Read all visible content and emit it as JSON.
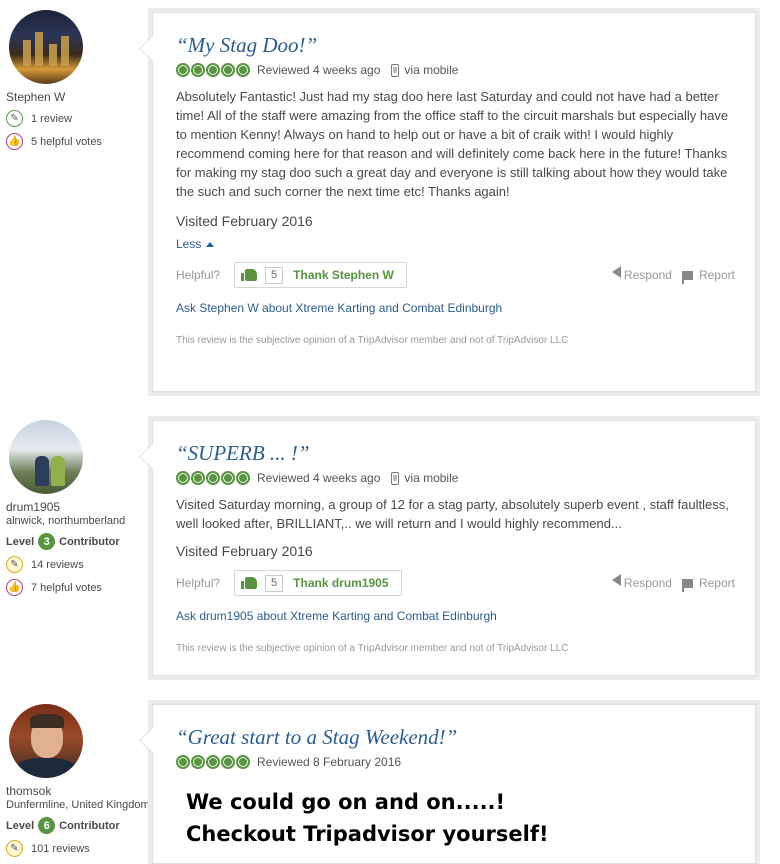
{
  "reviews": [
    {
      "member": {
        "name": "Stephen W",
        "location": "",
        "level": null,
        "reviews": "1 review",
        "helpful": "5 helpful votes"
      },
      "title": "“My Stag Doo!”",
      "reviewed": "Reviewed 4 weeks ago",
      "via": "via mobile",
      "body": "Absolutely Fantastic! Just had my stag doo here last Saturday and could not have had a better time! All of the staff were amazing from the office staff to the circuit marshals but especially have to mention Kenny! Always on hand to help out or have a bit of craik with! I would highly recommend coming here for that reason and will definitely come back here in the future! Thanks for making my stag doo such a great day and everyone is still talking about how they would take the such and such corner the next time etc! Thanks again!",
      "visited": "Visited February 2016",
      "less": "Less",
      "helpful_label": "Helpful?",
      "thank_count": "5",
      "thank_label": "Thank Stephen W",
      "respond": "Respond",
      "report": "Report",
      "ask": "Ask Stephen W about Xtreme Karting and Combat Edinburgh",
      "disclaimer": "This review is the subjective opinion of a TripAdvisor member and not of TripAdvisor LLC"
    },
    {
      "member": {
        "name": "drum1905",
        "location": "alnwick, northumberland",
        "level_label": "Level",
        "level": "3",
        "contributor": "Contributor",
        "reviews": "14 reviews",
        "helpful": "7 helpful votes"
      },
      "title": "“SUPERB ... !”",
      "reviewed": "Reviewed 4 weeks ago",
      "via": "via mobile",
      "body": "Visited Saturday morning, a group of 12 for a stag party, absolutely superb event , staff faultless, well looked after, BRILLIANT,.. we will return and I would highly recommend...",
      "visited": "Visited February 2016",
      "helpful_label": "Helpful?",
      "thank_count": "5",
      "thank_label": "Thank drum1905",
      "respond": "Respond",
      "report": "Report",
      "ask": "Ask drum1905 about Xtreme Karting and Combat Edinburgh",
      "disclaimer": "This review is the subjective opinion of a TripAdvisor member and not of TripAdvisor LLC"
    },
    {
      "member": {
        "name": "thomsok",
        "location": "Dunfermline, United Kingdom",
        "level_label": "Level",
        "level": "6",
        "contributor": "Contributor",
        "reviews": "101 reviews"
      },
      "title": "“Great start to a Stag Weekend!”",
      "reviewed": "Reviewed 8 February 2016"
    }
  ],
  "rating": {
    "bubbles": 5,
    "color": "#589442"
  },
  "overlay": {
    "line1": "We could go on and on.....!",
    "line2": "Checkout Tripadvisor yourself!"
  },
  "colors": {
    "link": "#2c5d8c",
    "accent": "#589442"
  }
}
